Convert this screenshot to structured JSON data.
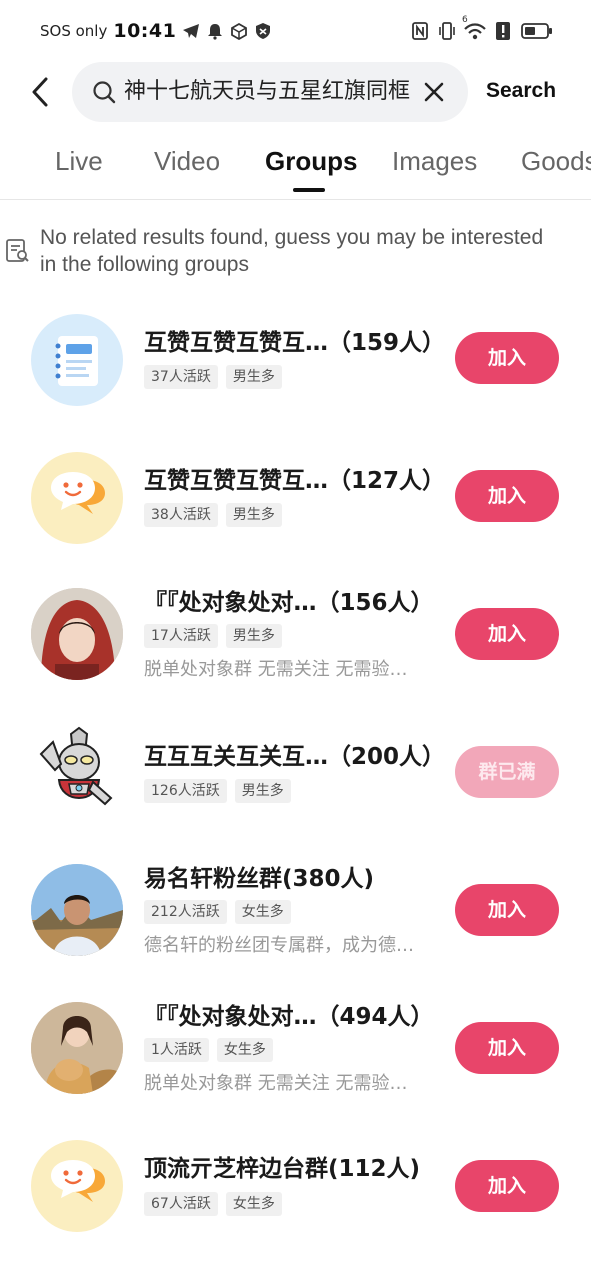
{
  "status_bar": {
    "carrier": "SOS only",
    "time": "10:41",
    "signal_badge": "6"
  },
  "search": {
    "query": "神十七航天员与五星红旗同框",
    "button_label": "Search"
  },
  "tabs": [
    {
      "label": "Live",
      "active": false
    },
    {
      "label": "Video",
      "active": false
    },
    {
      "label": "Groups",
      "active": true
    },
    {
      "label": "Images",
      "active": false
    },
    {
      "label": "Goods",
      "active": false
    }
  ],
  "notice": {
    "text": "No related results found, guess you may be interested in the following groups"
  },
  "groups": [
    {
      "title": "互赞互赞互赞互…（159人）",
      "tags": [
        "37人活跃",
        "男生多"
      ],
      "desc": "",
      "button": "加入",
      "full": false,
      "avatar": "notebook-icon"
    },
    {
      "title": "互赞互赞互赞互…（127人）",
      "tags": [
        "38人活跃",
        "男生多"
      ],
      "desc": "",
      "button": "加入",
      "full": false,
      "avatar": "chat-bubble-icon"
    },
    {
      "title": "『『处对象处对…（156人）",
      "tags": [
        "17人活跃",
        "男生多"
      ],
      "desc": "脱单处对象群 无需关注 无需验…",
      "button": "加入",
      "full": false,
      "avatar": "photo-red-hood"
    },
    {
      "title": "互互互关互关互…（200人）",
      "tags": [
        "126人活跃",
        "男生多"
      ],
      "desc": "",
      "button": "群已满",
      "full": true,
      "avatar": "ultraman-cartoon"
    },
    {
      "title": "易名轩粉丝群(380人)",
      "tags": [
        "212人活跃",
        "女生多"
      ],
      "desc": "德名轩的粉丝团专属群，成为德…",
      "button": "加入",
      "full": false,
      "avatar": "photo-man-outdoor"
    },
    {
      "title": "『『处对象处对…（494人）",
      "tags": [
        "1人活跃",
        "女生多"
      ],
      "desc": "脱单处对象群 无需关注 无需验…",
      "button": "加入",
      "full": false,
      "avatar": "photo-woman-dog"
    },
    {
      "title": "顶流亓芝梓边台群(112人)",
      "tags": [
        "67人活跃",
        "女生多"
      ],
      "desc": "",
      "button": "加入",
      "full": false,
      "avatar": "chat-bubble-icon"
    }
  ],
  "colors": {
    "accent": "#e8456a",
    "accent_disabled": "#f2a7b9",
    "tag_bg": "#f0f0f0"
  }
}
